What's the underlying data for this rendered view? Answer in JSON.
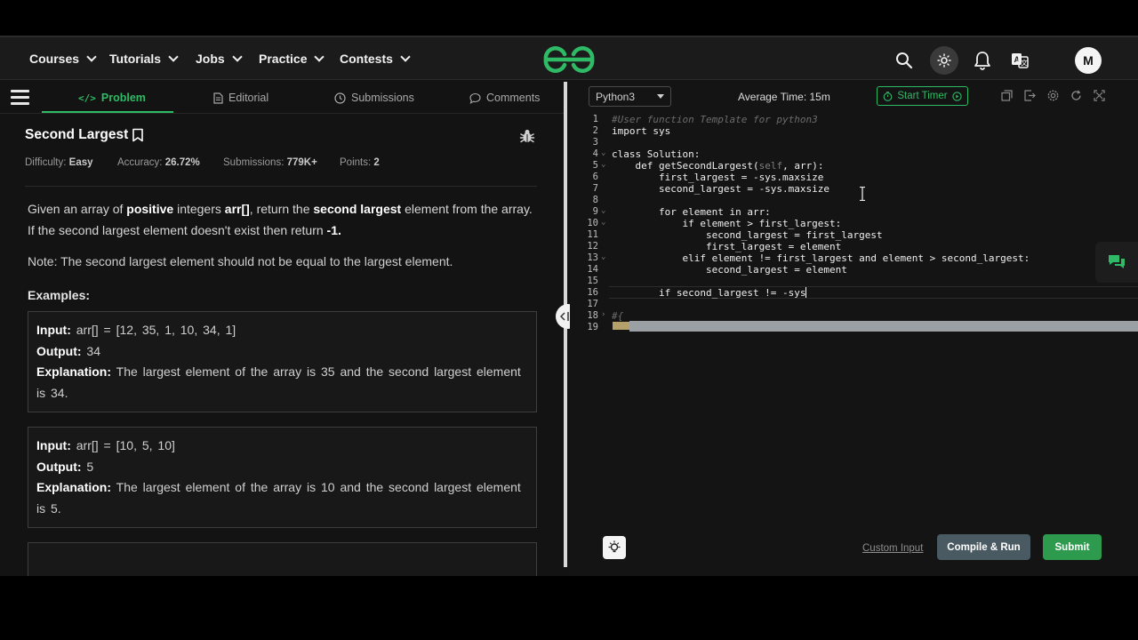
{
  "nav": {
    "items": [
      {
        "label": "Courses"
      },
      {
        "label": "Tutorials"
      },
      {
        "label": "Jobs"
      },
      {
        "label": "Practice"
      },
      {
        "label": "Contests"
      }
    ],
    "avatar_letter": "M",
    "brand_color": "#2fba66"
  },
  "tabs": [
    {
      "label": "Problem",
      "icon": "code-icon"
    },
    {
      "label": "Editorial",
      "icon": "document-icon"
    },
    {
      "label": "Submissions",
      "icon": "clock-icon"
    },
    {
      "label": "Comments",
      "icon": "comment-icon"
    }
  ],
  "problem": {
    "title": "Second Largest",
    "difficulty_label": "Difficulty:",
    "difficulty": "Easy",
    "accuracy_label": "Accuracy:",
    "accuracy": "26.72%",
    "submissions_label": "Submissions:",
    "submissions": "779K+",
    "points_label": "Points:",
    "points": "2",
    "desc_1": "Given an array of ",
    "desc_b1": "positive",
    "desc_2": " integers ",
    "desc_b2": "arr[]",
    "desc_3": ", return the ",
    "desc_b3": "second largest",
    "desc_4": " element from the array. If the second largest element doesn't exist then return ",
    "desc_b4": "-1.",
    "note": "Note: The second largest element should not be equal to the largest element.",
    "examples_heading": "Examples:",
    "examples": [
      {
        "input_label": "Input:",
        "input": "arr[] = [12, 35, 1, 10, 34, 1]",
        "output_label": "Output:",
        "output": "34",
        "explanation_label": "Explanation:",
        "explanation": "The largest element of the array is 35 and the second largest element is 34."
      },
      {
        "input_label": "Input:",
        "input": "arr[] = [10, 5, 10]",
        "output_label": "Output:",
        "output": "5",
        "explanation_label": "Explanation:",
        "explanation": "The largest element of the array is 10 and the second largest element is 5."
      }
    ]
  },
  "editor": {
    "language": "Python3",
    "avg_time": "Average Time: 15m",
    "start_timer": "Start Timer",
    "lines": [
      {
        "n": "1",
        "text": "#User function Template for python3",
        "type": "comment"
      },
      {
        "n": "2",
        "text": "import sys",
        "type": "code"
      },
      {
        "n": "3",
        "text": "",
        "type": "code"
      },
      {
        "n": "4",
        "text": "class Solution:",
        "type": "code"
      },
      {
        "n": "5",
        "text": "    def getSecondLargest(",
        "type": "code",
        "self": "self",
        "rest": ", arr):"
      },
      {
        "n": "6",
        "text": "        first_largest = -sys.maxsize",
        "type": "code"
      },
      {
        "n": "7",
        "text": "        second_largest = -sys.maxsize",
        "type": "code"
      },
      {
        "n": "8",
        "text": "",
        "type": "code"
      },
      {
        "n": "9",
        "text": "        for element in arr:",
        "type": "code"
      },
      {
        "n": "10",
        "text": "            if element > first_largest:",
        "type": "code"
      },
      {
        "n": "11",
        "text": "                second_largest = first_largest",
        "type": "code"
      },
      {
        "n": "12",
        "text": "                first_largest = element",
        "type": "code"
      },
      {
        "n": "13",
        "text": "            elif element != first_largest and element > second_largest:",
        "type": "code"
      },
      {
        "n": "14",
        "text": "                second_largest = element",
        "type": "code"
      },
      {
        "n": "15",
        "text": "",
        "type": "code"
      },
      {
        "n": "16",
        "text": "        if second_largest != -sys",
        "type": "code"
      },
      {
        "n": "17",
        "text": "",
        "type": "code"
      },
      {
        "n": "18",
        "text": "#{",
        "type": "comment"
      },
      {
        "n": "19",
        "text": "",
        "type": "code"
      }
    ],
    "custom_input": "Custom Input",
    "compile_run": "Compile & Run",
    "submit": "Submit"
  }
}
